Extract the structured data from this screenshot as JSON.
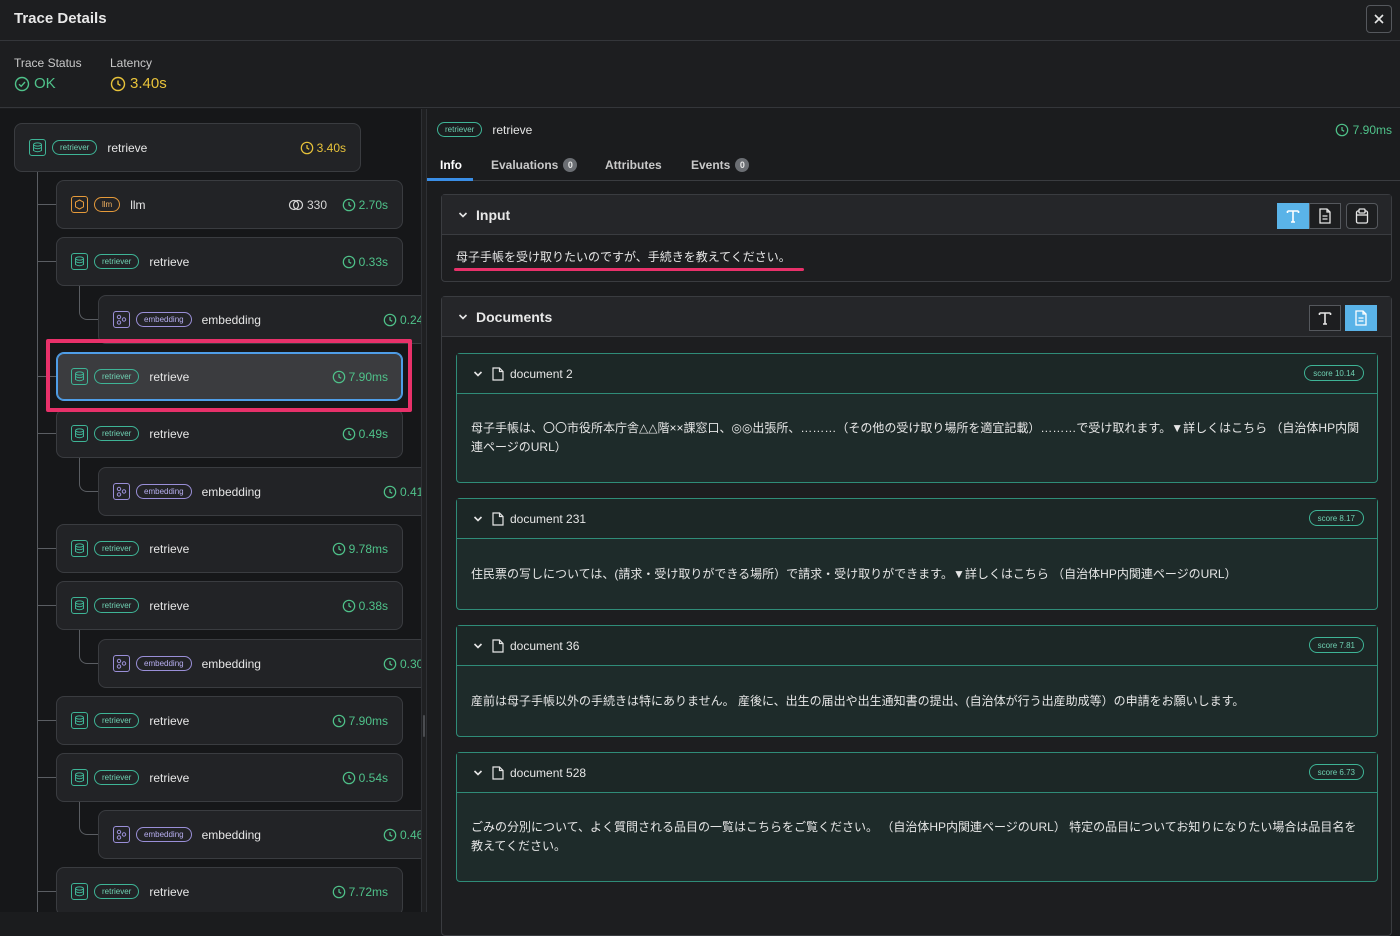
{
  "window": {
    "title": "Trace Details"
  },
  "status": {
    "trace_status_label": "Trace Status",
    "trace_status_value": "OK",
    "latency_label": "Latency",
    "latency_value": "3.40s"
  },
  "tree": {
    "root": {
      "badge": "retriever",
      "name": "retrieve",
      "latency": "3.40s"
    },
    "spans": [
      {
        "kind": "llm",
        "badge": "llm",
        "name": "llm",
        "tokens": "330",
        "latency": "2.70s"
      },
      {
        "kind": "ret",
        "badge": "retriever",
        "name": "retrieve",
        "latency": "0.33s"
      },
      {
        "kind": "emb",
        "badge": "embedding",
        "name": "embedding",
        "latency": "0.24"
      },
      {
        "kind": "ret",
        "badge": "retriever",
        "name": "retrieve",
        "latency": "7.90ms"
      },
      {
        "kind": "ret",
        "badge": "retriever",
        "name": "retrieve",
        "latency": "0.49s"
      },
      {
        "kind": "emb",
        "badge": "embedding",
        "name": "embedding",
        "latency": "0.41"
      },
      {
        "kind": "ret",
        "badge": "retriever",
        "name": "retrieve",
        "latency": "9.78ms"
      },
      {
        "kind": "ret",
        "badge": "retriever",
        "name": "retrieve",
        "latency": "0.38s"
      },
      {
        "kind": "emb",
        "badge": "embedding",
        "name": "embedding",
        "latency": "0.30"
      },
      {
        "kind": "ret",
        "badge": "retriever",
        "name": "retrieve",
        "latency": "7.90ms"
      },
      {
        "kind": "ret",
        "badge": "retriever",
        "name": "retrieve",
        "latency": "0.54s"
      },
      {
        "kind": "emb",
        "badge": "embedding",
        "name": "embedding",
        "latency": "0.46"
      },
      {
        "kind": "ret",
        "badge": "retriever",
        "name": "retrieve",
        "latency": "7.72ms"
      }
    ]
  },
  "detail": {
    "badge": "retriever",
    "name": "retrieve",
    "latency": "7.90ms",
    "tabs": [
      {
        "label": "Info"
      },
      {
        "label": "Evaluations",
        "count": "0"
      },
      {
        "label": "Attributes"
      },
      {
        "label": "Events",
        "count": "0"
      }
    ],
    "input": {
      "title": "Input",
      "text": "母子手帳を受け取りたいのですが、手続きを教えてください。"
    },
    "documents": {
      "title": "Documents",
      "items": [
        {
          "name": "document 2",
          "score": "score 10.14",
          "text": "母子手帳は、〇〇市役所本庁舎△△階××課窓口、◎◎出張所、………（その他の受け取り場所を適宜記載）………で受け取れます。▼詳しくはこちら （自治体HP内関連ページのURL）"
        },
        {
          "name": "document 231",
          "score": "score 8.17",
          "text": "住民票の写しについては、(請求・受け取りができる場所）で請求・受け取りができます。▼詳しくはこちら （自治体HP内関連ページのURL）"
        },
        {
          "name": "document 36",
          "score": "score 7.81",
          "text": "産前は母子手帳以外の手続きは特にありません。 産後に、出生の届出や出生通知書の提出、(自治体が行う出産助成等）の申請をお願いします。"
        },
        {
          "name": "document 528",
          "score": "score 6.73",
          "text": "ごみの分別について、よく質問される品目の一覧はこちらをご覧ください。 （自治体HP内関連ページのURL） 特定の品目についてお知りになりたい場合は品目名を教えてください。"
        }
      ]
    }
  },
  "colors": {
    "accent": "#3a8ee6",
    "ok": "#4fc28a",
    "latency_yellow": "#e8c33a",
    "highlight": "#e8316a",
    "retriever": "#3eb496"
  }
}
